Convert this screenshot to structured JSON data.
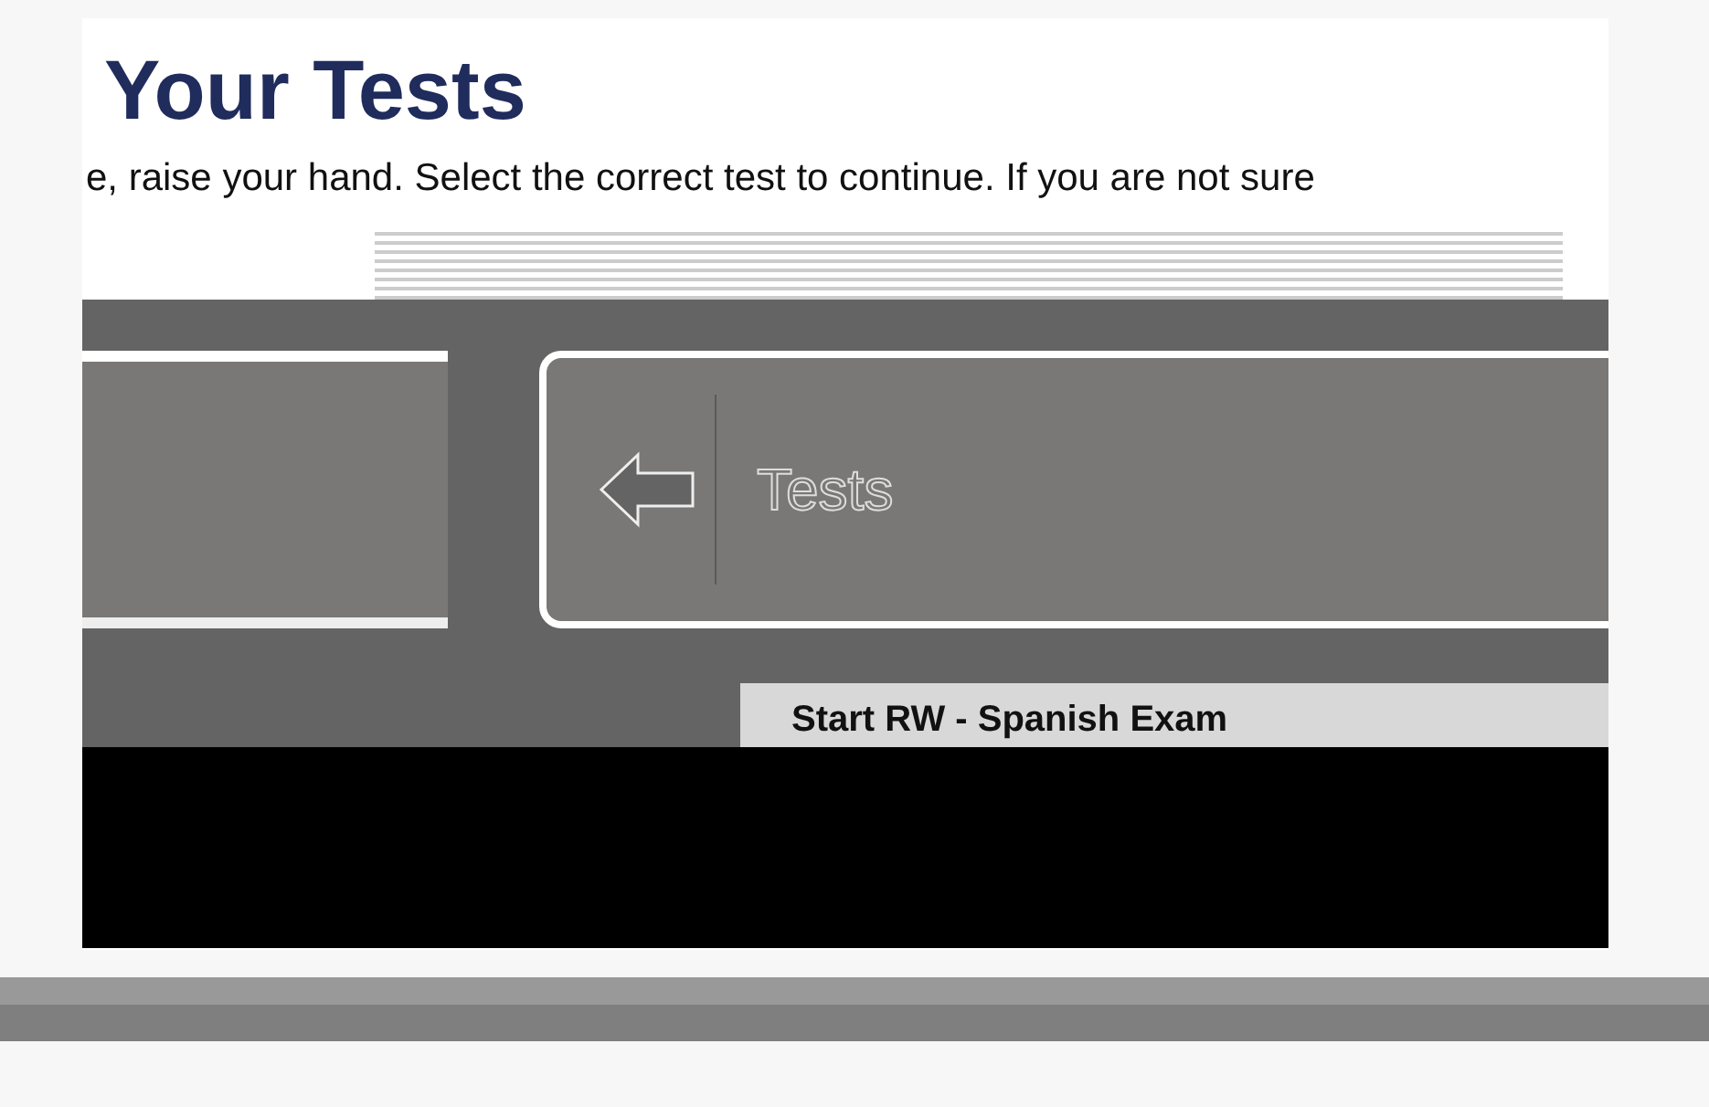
{
  "header": {
    "title": "Your Tests",
    "instructions": "e, raise your hand. Select the correct test to continue. If you are not sure"
  },
  "section": {
    "title": "Tests"
  },
  "test": {
    "name": "Start RW - Spanish Exam"
  }
}
